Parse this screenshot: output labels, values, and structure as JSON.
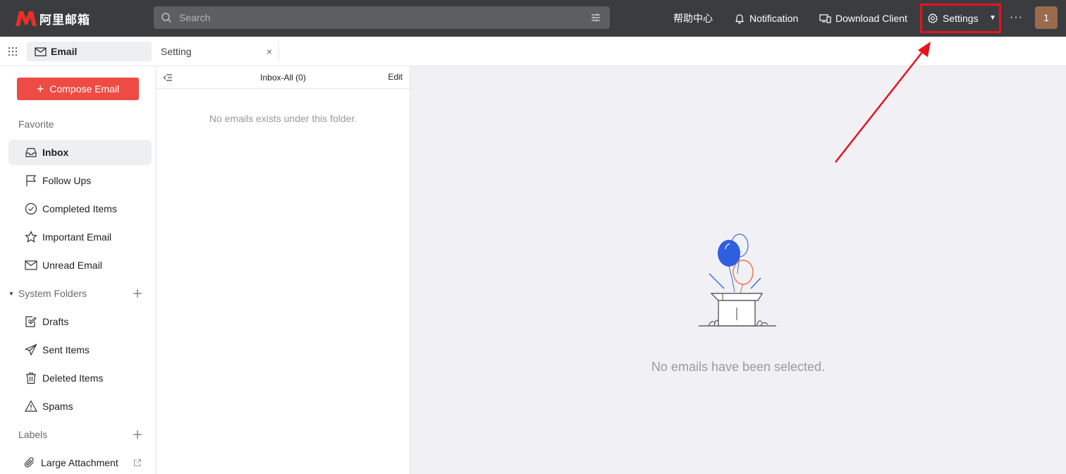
{
  "topbar": {
    "logo_text": "阿里邮箱",
    "search_placeholder": "Search",
    "help_center": "帮助中心",
    "notification": "Notification",
    "download_client": "Download Client",
    "settings": "Settings",
    "more": "···",
    "avatar_text": "1",
    "accent_color": "#ee4b44",
    "highlight_color": "#e8121f"
  },
  "tabs": {
    "email": "Email",
    "setting": "Setting",
    "close_symbol": "×"
  },
  "sidebar": {
    "compose": "Compose Email",
    "favorite_title": "Favorite",
    "favorites": [
      {
        "label": "Inbox",
        "icon": "inbox-icon"
      },
      {
        "label": "Follow Ups",
        "icon": "flag-icon"
      },
      {
        "label": "Completed Items",
        "icon": "check-circle-icon"
      },
      {
        "label": "Important Email",
        "icon": "star-icon"
      },
      {
        "label": "Unread Email",
        "icon": "envelope-icon"
      }
    ],
    "system_folders_title": "System Folders",
    "system_folders": [
      {
        "label": "Drafts",
        "icon": "draft-icon"
      },
      {
        "label": "Sent Items",
        "icon": "send-icon"
      },
      {
        "label": "Deleted Items",
        "icon": "trash-icon"
      },
      {
        "label": "Spams",
        "icon": "warning-icon"
      }
    ],
    "labels_title": "Labels",
    "labels": [
      {
        "label": "Large Attachment",
        "icon": "paperclip-icon"
      }
    ]
  },
  "maillist": {
    "title": "Inbox-All (0)",
    "edit": "Edit",
    "empty": "No emails exists under this folder."
  },
  "reading": {
    "empty": "No emails have been selected."
  }
}
